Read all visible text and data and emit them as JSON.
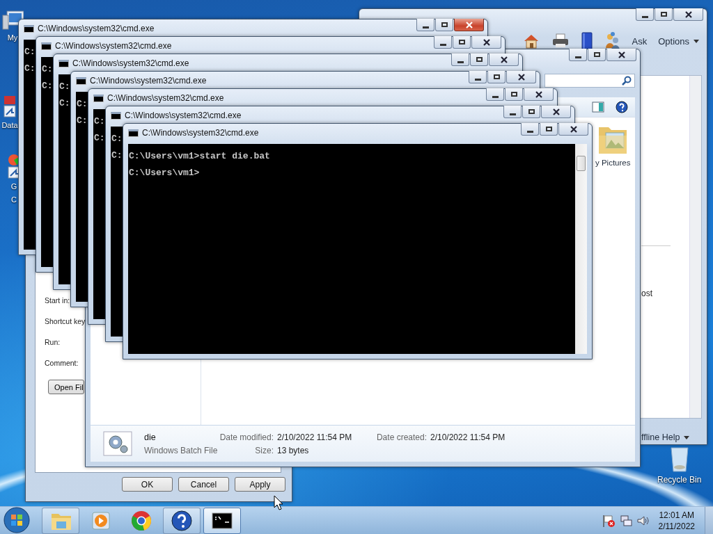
{
  "desktop_icons": [
    {
      "lines": [
        "My"
      ]
    },
    {
      "lines": [
        "Data"
      ]
    },
    {
      "lines": [
        "G",
        "C"
      ]
    }
  ],
  "recycle_bin": {
    "label": "Recycle Bin"
  },
  "help_window": {
    "toolbar_buttons": [
      {
        "label": "Ask"
      },
      {
        "label": "Options"
      }
    ],
    "content_text": "ost",
    "footer_menu": "ffline Help"
  },
  "properties_dialog": {
    "fields": [
      {
        "label": "Start in:"
      },
      {
        "label": "Shortcut key"
      },
      {
        "label": "Run:"
      },
      {
        "label": "Comment:"
      }
    ],
    "open_button": "Open Fil",
    "buttons": [
      "OK",
      "Cancel",
      "Apply"
    ]
  },
  "explorer": {
    "items": [
      {
        "label": "y Pictures"
      }
    ],
    "details": {
      "name": "die",
      "type": "Windows Batch File",
      "properties": [
        {
          "label": "Date modified:",
          "value": "2/10/2022 11:54 PM"
        },
        {
          "label": "Size:",
          "value": "13 bytes"
        },
        {
          "label": "Date created:",
          "value": "2/10/2022 11:54 PM"
        }
      ]
    }
  },
  "cmd_windows": [
    {
      "title": "C:\\Windows\\system32\\cmd.exe",
      "active": true,
      "lines": [
        "C:",
        "C:"
      ]
    },
    {
      "title": "C:\\Windows\\system32\\cmd.exe",
      "active": false,
      "lines": [
        "C:",
        "C:"
      ]
    },
    {
      "title": "C:\\Windows\\system32\\cmd.exe",
      "active": false,
      "lines": [
        "C:",
        "C:"
      ]
    },
    {
      "title": "C:\\Windows\\system32\\cmd.exe",
      "active": false,
      "lines": [
        "C:",
        "C:"
      ]
    },
    {
      "title": "C:\\Windows\\system32\\cmd.exe",
      "active": false,
      "lines": [
        "C:",
        "C:"
      ]
    },
    {
      "title": "C:\\Windows\\system32\\cmd.exe",
      "active": false,
      "lines": [
        "C:",
        "C:"
      ]
    },
    {
      "title": "C:\\Windows\\system32\\cmd.exe",
      "active": false,
      "lines": [
        "C:\\Users\\vm1>start die.bat",
        "C:\\Users\\vm1>"
      ]
    }
  ],
  "taskbar": {
    "buttons": [
      {
        "running": true,
        "selected": false
      },
      {
        "running": false,
        "selected": false
      },
      {
        "running": false,
        "selected": false
      },
      {
        "running": true,
        "selected": false
      },
      {
        "running": true,
        "selected": true
      }
    ],
    "clock": {
      "time": "12:01 AM",
      "date": "2/11/2022"
    }
  }
}
